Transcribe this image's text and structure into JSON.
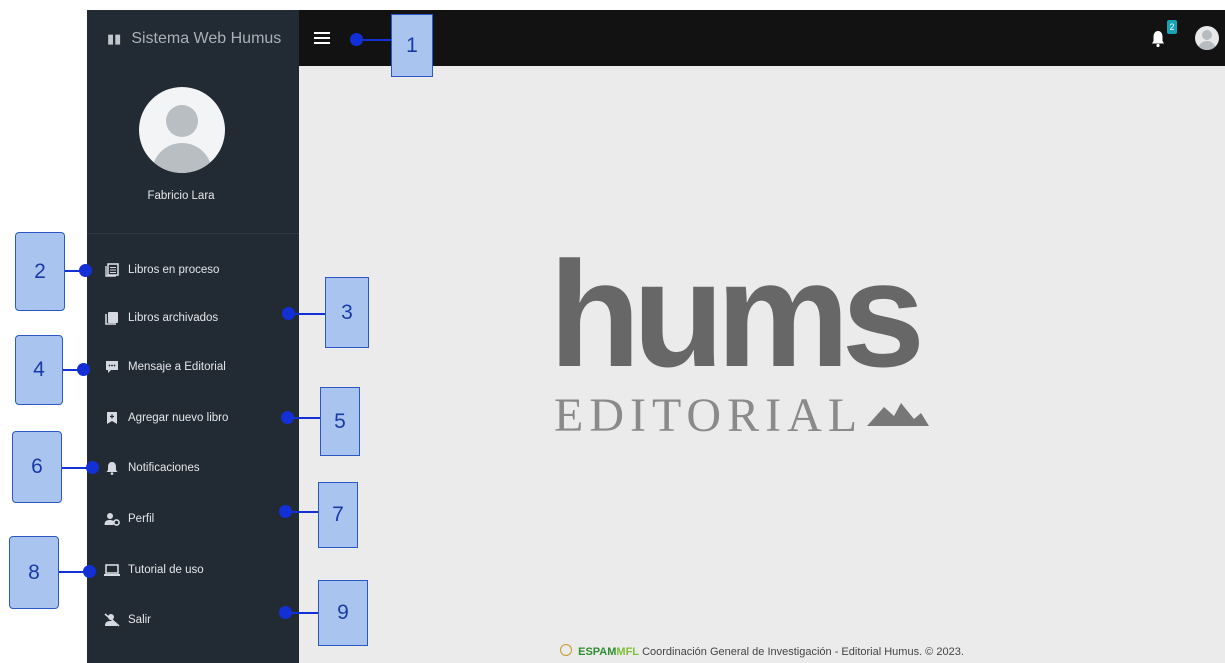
{
  "sidebar": {
    "brand": "Sistema Web Humus",
    "user_name": "Fabricio Lara",
    "items": [
      {
        "label": "Libros en proceso"
      },
      {
        "label": "Libros archivados"
      },
      {
        "label": "Mensaje a Editorial"
      },
      {
        "label": "Agregar nuevo libro"
      },
      {
        "label": "Notificaciones"
      },
      {
        "label": "Perfil"
      },
      {
        "label": "Tutorial de uso"
      },
      {
        "label": "Salir"
      }
    ]
  },
  "topbar": {
    "notification_count": "2"
  },
  "logo": {
    "main_text": "hums",
    "sub_text": "EDITORIAL"
  },
  "footer": {
    "brand_a": "ESPAM",
    "brand_b": "MFL",
    "text": "Coordinación General de Investigación - Editorial Humus. © 2023."
  },
  "annotations": [
    "1",
    "2",
    "3",
    "4",
    "5",
    "6",
    "7",
    "8",
    "9"
  ],
  "colors": {
    "sidebar_bg": "#222a33",
    "topbar_bg": "#121212",
    "main_bg": "#ebebeb",
    "annotation_fill": "#a9c5ef",
    "annotation_line": "#1330d6",
    "badge": "#17a2b8"
  }
}
